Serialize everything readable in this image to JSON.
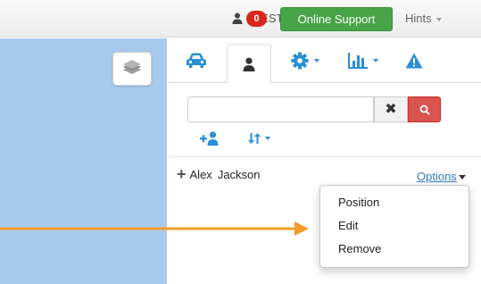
{
  "topbar": {
    "user_label": "4TEST",
    "notification_count": "0",
    "support_label": "Online Support",
    "hints_label": "Hints"
  },
  "tabs": [
    {
      "icon": "car-icon"
    },
    {
      "icon": "user-icon",
      "active": true
    },
    {
      "icon": "gear-icon"
    },
    {
      "icon": "bar-chart-icon"
    },
    {
      "icon": "warning-icon"
    }
  ],
  "search": {
    "value": "",
    "placeholder": "",
    "clear_label": "✖"
  },
  "list": {
    "item": {
      "first_name": "Alex",
      "last_name": "Jackson"
    },
    "options_label": "Options"
  },
  "menu": {
    "items": [
      "Position",
      "Edit",
      "Remove"
    ]
  },
  "colors": {
    "accent": "#2b8fd6",
    "support": "#47a447",
    "danger": "#d9534f",
    "badge": "#d9261c",
    "map": "#a6cbed",
    "annotation": "#f39c2b"
  }
}
